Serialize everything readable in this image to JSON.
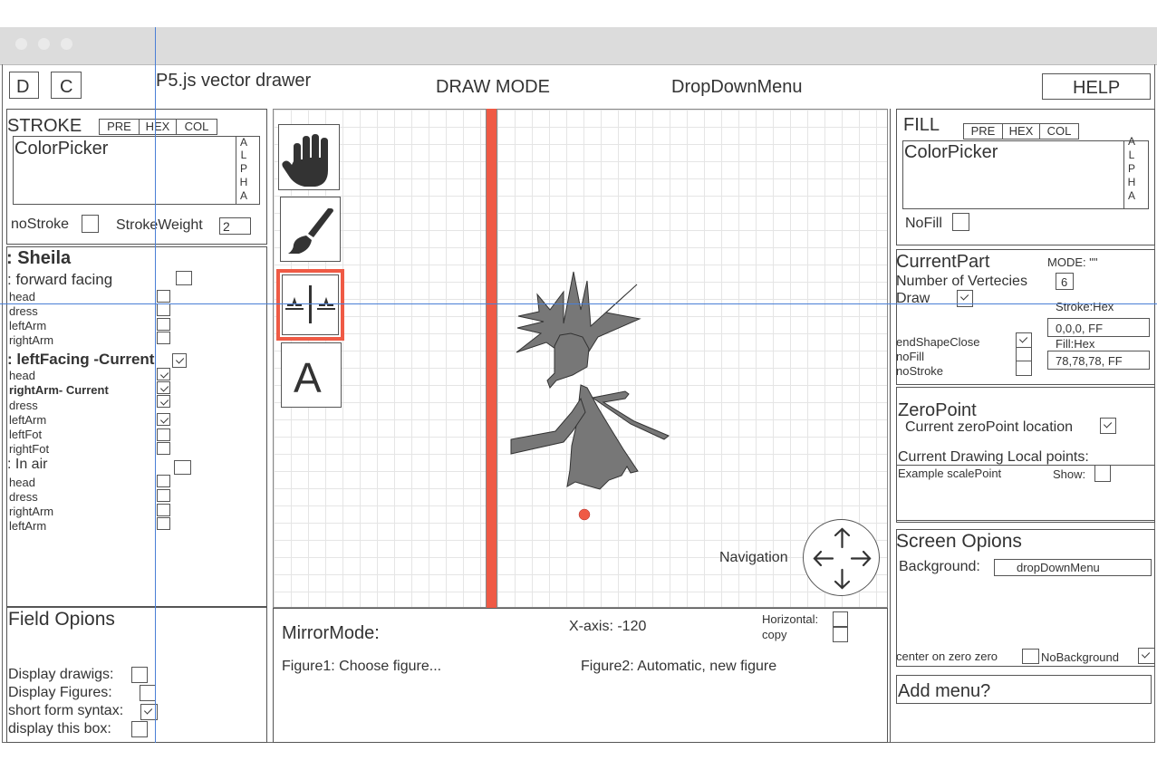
{
  "header": {
    "d_button": "D",
    "c_button": "C",
    "app_title": "P5.js vector drawer",
    "mode": "DRAW MODE",
    "dropdown": "DropDownMenu",
    "help_button": "HELP"
  },
  "stroke_panel": {
    "title": "STROKE",
    "tabs": [
      "PRE",
      "HEX",
      "COL"
    ],
    "picker_label": "ColorPicker",
    "alpha_letters": [
      "A",
      "L",
      "P",
      "H",
      "A"
    ],
    "no_stroke_label": "noStroke",
    "stroke_weight_label": "StrokeWeight",
    "stroke_weight_value": "2"
  },
  "figure_panel": {
    "name": ": Sheila",
    "groups": [
      {
        "label": ": forward facing",
        "checked": false,
        "parts": [
          {
            "label": "head",
            "checked": false
          },
          {
            "label": "dress",
            "checked": false
          },
          {
            "label": "leftArm",
            "checked": false
          },
          {
            "label": "rightArm",
            "checked": false
          }
        ]
      },
      {
        "label": ": leftFacing -Current",
        "checked": true,
        "parts": [
          {
            "label": "head",
            "checked": true
          },
          {
            "label": "rightArm- Current",
            "checked": true,
            "bold": true
          },
          {
            "label": "dress",
            "checked": true
          },
          {
            "label": "leftArm",
            "checked": true
          },
          {
            "label": "leftFot",
            "checked": false
          },
          {
            "label": "rightFot",
            "checked": false
          }
        ]
      },
      {
        "label": ": In air",
        "checked": false,
        "parts": [
          {
            "label": "head",
            "checked": false
          },
          {
            "label": "dress",
            "checked": false
          },
          {
            "label": "rightArm",
            "checked": false
          },
          {
            "label": "leftArm",
            "checked": false
          }
        ]
      }
    ]
  },
  "field_options": {
    "title": "Field Opions",
    "items": [
      {
        "label": "Display drawigs:",
        "checked": false
      },
      {
        "label": "Display Figures:",
        "checked": false
      },
      {
        "label": "short form syntax:",
        "checked": true
      },
      {
        "label": "display this box:",
        "checked": false
      }
    ]
  },
  "tools": [
    {
      "name": "hand-tool",
      "icon": "hand-icon"
    },
    {
      "name": "brush-tool",
      "icon": "paintbrush-icon"
    },
    {
      "name": "mirror-tool",
      "icon": "mirror-icon",
      "selected": true
    },
    {
      "name": "text-tool",
      "icon": "text-icon",
      "glyph": "A"
    }
  ],
  "canvas": {
    "navigation_label": "Navigation",
    "mirror_line_color": "#ef5a45",
    "figure_color": "#777777",
    "zero_point_color": "#ef5a45"
  },
  "mirror_bar": {
    "label": "MirrorMode:",
    "x_axis": "X-axis: -120",
    "horizontal_label": "Horizontal:",
    "copy_label": "copy",
    "figure1": "Figure1: Choose figure...",
    "figure2": "Figure2: Automatic, new figure"
  },
  "fill_panel": {
    "title": "FILL",
    "tabs": [
      "PRE",
      "HEX",
      "COL"
    ],
    "picker_label": "ColorPicker",
    "alpha_letters": [
      "A",
      "L",
      "P",
      "H",
      "A"
    ],
    "no_fill_label": "NoFill"
  },
  "current_part": {
    "title": "CurrentPart",
    "mode": "MODE: \"\"",
    "vertices_label": "Number of Vertecies",
    "vertices_value": "6",
    "draw_label": "Draw",
    "stroke_hex_label": "Stroke:Hex",
    "stroke_hex_value": "0,0,0, FF",
    "fill_hex_label": "Fill:Hex",
    "fill_hex_value": "78,78,78, FF",
    "end_shape_close": "endShapeClose",
    "no_fill": "noFill",
    "no_stroke": "noStroke"
  },
  "zero_point": {
    "title": "ZeroPoint",
    "location_label": "Current zeroPoint location",
    "local_points_label": "Current Drawing Local points:",
    "example_label": "Example scalePoint",
    "show_label": "Show:"
  },
  "screen_options": {
    "title": "Screen Opions",
    "background_label": "Background:",
    "background_value": "dropDownMenu",
    "center_label": "center on zero zero",
    "no_background_label": "NoBackground"
  },
  "add_menu": {
    "label": "Add menu?"
  }
}
